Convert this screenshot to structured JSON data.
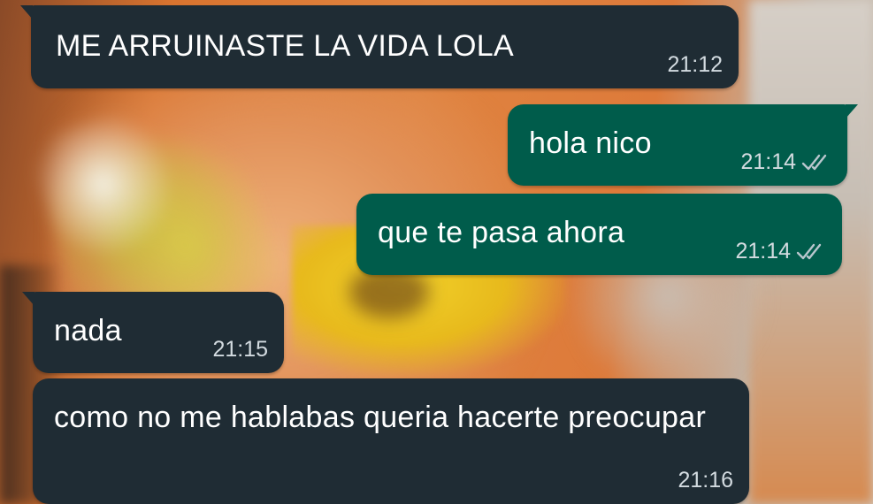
{
  "messages": [
    {
      "direction": "incoming",
      "text": "ME ARRUINASTE LA VIDA LOLA",
      "time": "21:12"
    },
    {
      "direction": "outgoing",
      "text": "hola nico",
      "time": "21:14",
      "status_icon": "double-check-icon"
    },
    {
      "direction": "outgoing",
      "text": "que te pasa ahora",
      "time": "21:14",
      "status_icon": "double-check-icon"
    },
    {
      "direction": "incoming",
      "text": "nada",
      "time": "21:15"
    },
    {
      "direction": "incoming",
      "text": "como no me hablabas queria hacerte preocupar",
      "time": "21:16"
    }
  ],
  "colors": {
    "incoming_bubble": "#1f2c34",
    "outgoing_bubble": "#005c4b",
    "text": "#ffffff",
    "time": "#d3dbe0",
    "tick": "#b8c6cd"
  }
}
